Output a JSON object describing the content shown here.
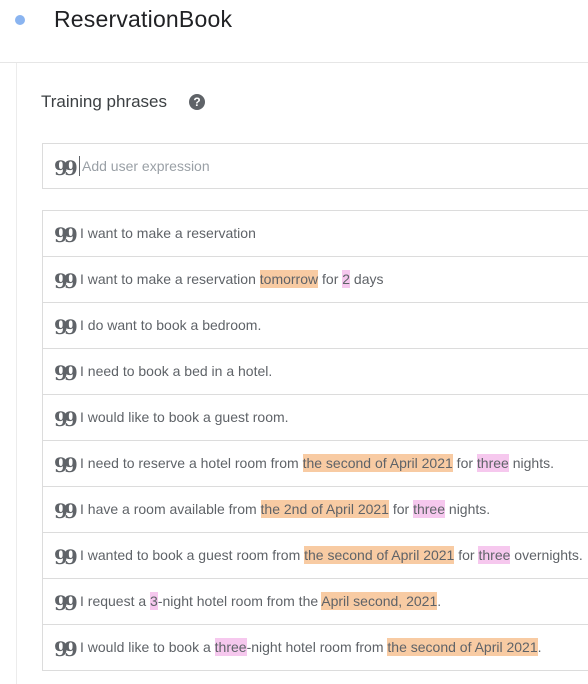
{
  "header": {
    "intent_name": "ReservationBook"
  },
  "training": {
    "title": "Training phrases",
    "help_icon": "question-circle-icon",
    "add_placeholder": "Add user expression",
    "quote_icon": "quote-icon",
    "quote_glyph": "99",
    "phrases": [
      [
        {
          "t": "I want to make a reservation"
        }
      ],
      [
        {
          "t": "I want to make a reservation "
        },
        {
          "t": "tomorrow",
          "h": "date"
        },
        {
          "t": " for "
        },
        {
          "t": "2",
          "h": "num"
        },
        {
          "t": " days"
        }
      ],
      [
        {
          "t": "I do want to book a bedroom."
        }
      ],
      [
        {
          "t": "I need to book a bed in a hotel."
        }
      ],
      [
        {
          "t": "I would like to book a guest room."
        }
      ],
      [
        {
          "t": "I need to reserve a hotel room from "
        },
        {
          "t": "the second of April 2021",
          "h": "date"
        },
        {
          "t": " for "
        },
        {
          "t": "three",
          "h": "num"
        },
        {
          "t": " nights."
        }
      ],
      [
        {
          "t": "I have a room available from "
        },
        {
          "t": "the 2nd of April 2021",
          "h": "date"
        },
        {
          "t": " for "
        },
        {
          "t": "three",
          "h": "num"
        },
        {
          "t": " nights."
        }
      ],
      [
        {
          "t": "I wanted to book a guest room from "
        },
        {
          "t": "the second of April 2021",
          "h": "date"
        },
        {
          "t": " for "
        },
        {
          "t": "three",
          "h": "num"
        },
        {
          "t": " overnights."
        }
      ],
      [
        {
          "t": "I request a "
        },
        {
          "t": "3",
          "h": "num"
        },
        {
          "t": "-night hotel room from the "
        },
        {
          "t": "April second, 2021",
          "h": "date"
        },
        {
          "t": "."
        }
      ],
      [
        {
          "t": "I would like to book a "
        },
        {
          "t": "three",
          "h": "num"
        },
        {
          "t": "-night hotel room from "
        },
        {
          "t": "the second of April 2021",
          "h": "date"
        },
        {
          "t": "."
        }
      ]
    ]
  },
  "colors": {
    "date_highlight": "#f8cba3",
    "number_highlight": "#f6c8ee",
    "status_dot": "#8ab4f0"
  }
}
